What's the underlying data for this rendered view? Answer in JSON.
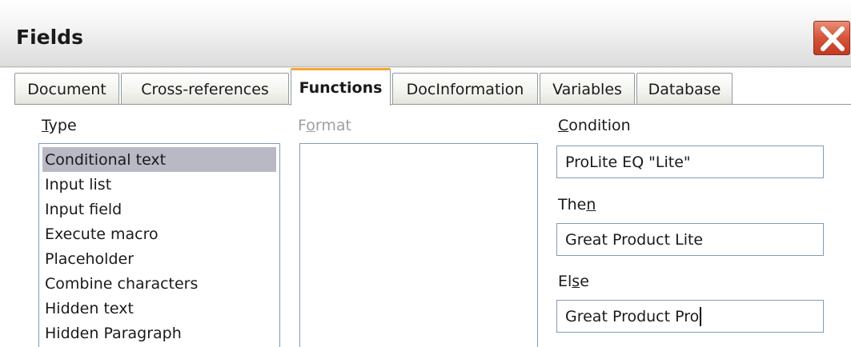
{
  "window": {
    "title": "Fields"
  },
  "tabs": [
    {
      "label": "Document",
      "active": false
    },
    {
      "label": "Cross-references",
      "active": false
    },
    {
      "label": "Functions",
      "active": true
    },
    {
      "label": "DocInformation",
      "active": false
    },
    {
      "label": "Variables",
      "active": false
    },
    {
      "label": "Database",
      "active": false
    }
  ],
  "type_panel": {
    "label_pre": "",
    "label_ul": "T",
    "label_post": "ype",
    "items": [
      "Conditional text",
      "Input list",
      "Input field",
      "Execute macro",
      "Placeholder",
      "Combine characters",
      "Hidden text",
      "Hidden Paragraph"
    ],
    "selected": "Conditional text"
  },
  "format_panel": {
    "label_pre": "F",
    "label_ul": "o",
    "label_post": "rmat"
  },
  "condition": {
    "label_pre": "",
    "label_ul": "C",
    "label_post": "ondition",
    "value": "ProLite EQ \"Lite\""
  },
  "then": {
    "label_pre": "The",
    "label_ul": "n",
    "label_post": "",
    "value": "Great Product Lite"
  },
  "else": {
    "label_pre": "El",
    "label_ul": "s",
    "label_post": "e",
    "value": "Great Product Pro"
  },
  "icons": {
    "close": "close-icon"
  },
  "colors": {
    "close_button": "#d4543a",
    "active_tab_accent": "#f4a73a",
    "selection": "#b9b9c6"
  }
}
